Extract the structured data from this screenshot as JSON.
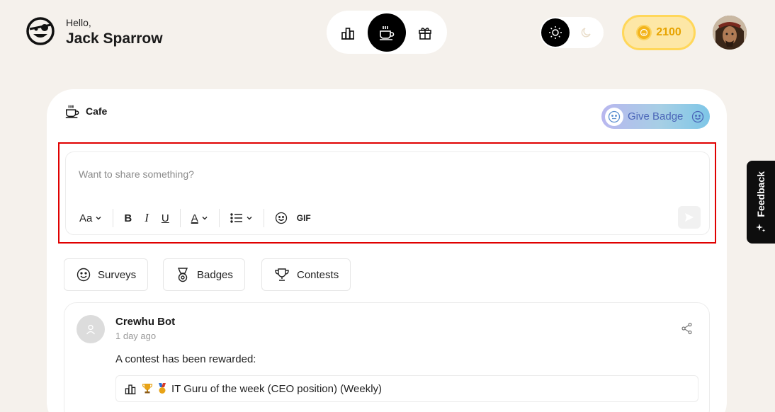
{
  "header": {
    "greeting": "Hello,",
    "user_name": "Jack Sparrow",
    "nav": [
      {
        "icon": "leaderboard-icon",
        "active": false
      },
      {
        "icon": "coffee-cup-icon",
        "active": true
      },
      {
        "icon": "gift-icon",
        "active": false
      }
    ],
    "theme": {
      "selected": "light"
    },
    "coins": "2100"
  },
  "main": {
    "section_title": "Cafe",
    "give_badge_label": "Give Badge",
    "composer": {
      "placeholder": "Want to share something?",
      "toolbar": {
        "font_label": "Aa",
        "bold": "B",
        "italic": "I",
        "underline": "U",
        "text_color": "A",
        "gif_label": "GIF"
      }
    },
    "chips": [
      {
        "label": "Surveys",
        "icon": "smiley-icon"
      },
      {
        "label": "Badges",
        "icon": "medal-icon"
      },
      {
        "label": "Contests",
        "icon": "trophy-icon"
      }
    ],
    "post": {
      "author": "Crewhu Bot",
      "time": "1 day ago",
      "body": "A contest has been rewarded:",
      "contest_title": "IT Guru of the week (CEO position) (Weekly)"
    }
  },
  "feedback_label": "Feedback",
  "colors": {
    "background": "#f5f1ec",
    "accent_black": "#000000",
    "coin_gold": "#f3b41b",
    "highlight_red": "#e00000"
  }
}
